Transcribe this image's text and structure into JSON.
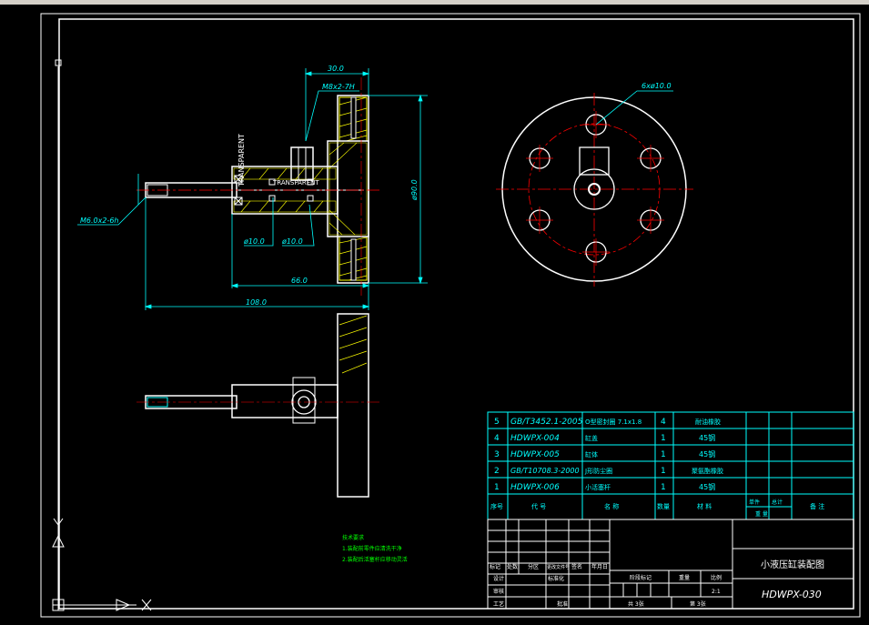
{
  "colors": {
    "background": "#000000",
    "frame": "#ffffff",
    "dimension": "#00ffff",
    "hatch": "#ffff00",
    "center": "#ff0000",
    "note": "#00ff00",
    "table_line": "#00ffff"
  },
  "dimensions": {
    "top_width": "30.0",
    "thread": "M8x2-7H",
    "height": "ø90.0",
    "inner_len": "66.0",
    "total_len": "108.0",
    "shaft_thread": "M6.0x2-6h",
    "dia_left": "ø10.0",
    "dia_right": "ø10.0",
    "holes": "6xø10.0"
  },
  "labels": {
    "rotated_1": "TRANSPARENT",
    "rotated_2": "TRANSPARENT"
  },
  "notes": {
    "title": "技术要求",
    "line1": "1.装配前零件应清洗干净",
    "line2": "2.装配后活塞杆应移动灵活"
  },
  "bom": [
    {
      "no": "5",
      "code": "GB/T3452.1-2005",
      "name": "O型密封圈 7.1x1.8",
      "qty": "4",
      "material": "耐油橡胶"
    },
    {
      "no": "4",
      "code": "HDWPX-004",
      "name": "缸盖",
      "qty": "1",
      "material": "45钢"
    },
    {
      "no": "3",
      "code": "HDWPX-005",
      "name": "缸体",
      "qty": "1",
      "material": "45钢"
    },
    {
      "no": "2",
      "code": "GB/T10708.3-2000",
      "name": "J形防尘圈",
      "qty": "1",
      "material": "聚氨酯橡胶"
    },
    {
      "no": "1",
      "code": "HDWPX-006",
      "name": "小活塞杆",
      "qty": "1",
      "material": "45钢"
    }
  ],
  "bom_header": {
    "no": "序号",
    "code": "代 号",
    "name": "名 称",
    "qty": "数量",
    "material": "材 料",
    "single": "单件",
    "total": "总计",
    "weight": "重 量",
    "remark": "备 注"
  },
  "title_block": {
    "drawing_name": "小液压缸装配图",
    "drawing_code": "HDWPX-030",
    "mark": "标记",
    "count": "处数",
    "zone": "分区",
    "change_doc": "更改文件号",
    "sign": "签名",
    "date": "年月日",
    "design": "设计",
    "standard": "标准化",
    "review": "审核",
    "process": "工艺",
    "approve": "批准",
    "stage_mark": "阶段标记",
    "weight": "重量",
    "scale": "比例",
    "scale_value": "2:1",
    "sheets": "共 3张",
    "sheet": "第 3张"
  },
  "ucs": {
    "x_label": "X",
    "y_label": "Y"
  }
}
